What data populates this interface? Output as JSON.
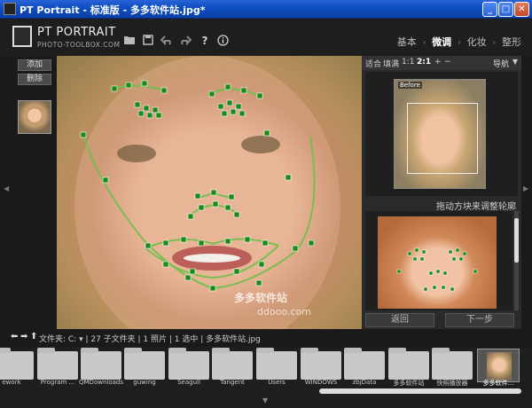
{
  "window": {
    "title": "PT Portrait - 标准版 - 多多软件站.jpg*",
    "buttons": [
      "_",
      "□",
      "✕"
    ]
  },
  "header": {
    "logo_title": "PT PORTRAIT",
    "logo_subtitle": "PHOTO-TOOLBOX.COM",
    "tools": [
      "folder-open-icon",
      "save-icon",
      "undo-icon",
      "redo-icon",
      "help-icon",
      "info-icon"
    ],
    "modes": [
      {
        "label": "基本",
        "active": false
      },
      {
        "label": "微调",
        "active": true
      },
      {
        "label": "化妆",
        "active": false
      },
      {
        "label": "整形",
        "active": false
      }
    ],
    "mode_separator": "›"
  },
  "left": {
    "add_label": "添加",
    "delete_label": "删除"
  },
  "navigator": {
    "zoom_fit": "适合",
    "zoom_fill": "填满",
    "zoom_1_1": "1:1",
    "zoom_2_1": "2:1",
    "zoom_plus": "+",
    "zoom_minus": "−",
    "label": "导航",
    "before_label": "Before"
  },
  "hint": "拖动方块来调整轮廓",
  "buttons": {
    "back": "返回",
    "next": "下一步"
  },
  "filebar": {
    "info": "文件夹: C: ▾ | 27 子文件夹 | 1 照片 | 1 选中 | 多多软件站.jpg"
  },
  "folders": [
    "ework",
    "Program ...",
    "QMDownloads",
    "guwing",
    "Seagull",
    "Tangent",
    "Users",
    "WINDOWS",
    "zbjData",
    "多多软件站",
    "快照播放器"
  ],
  "selected_photo": "多多软件...",
  "watermark": {
    "line1": "多多软件站",
    "line2": "ddooo.com"
  }
}
